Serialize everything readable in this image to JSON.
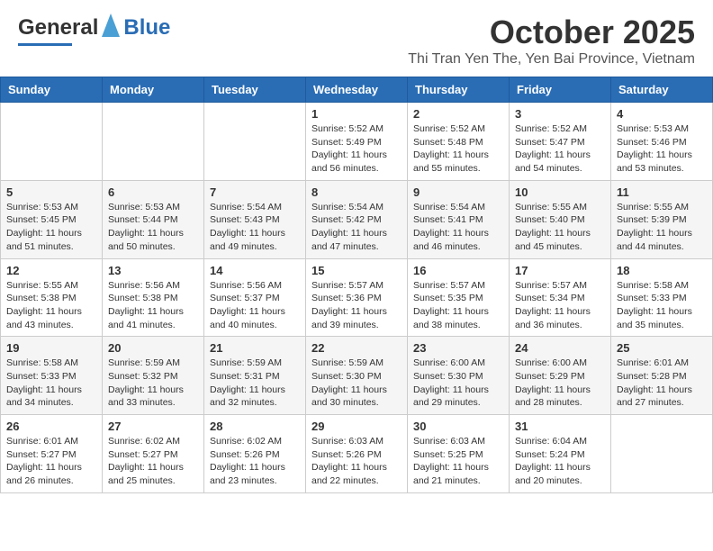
{
  "header": {
    "logo_general": "General",
    "logo_blue": "Blue",
    "month_title": "October 2025",
    "location": "Thi Tran Yen The, Yen Bai Province, Vietnam"
  },
  "weekdays": [
    "Sunday",
    "Monday",
    "Tuesday",
    "Wednesday",
    "Thursday",
    "Friday",
    "Saturday"
  ],
  "weeks": [
    [
      {
        "day": "",
        "info": ""
      },
      {
        "day": "",
        "info": ""
      },
      {
        "day": "",
        "info": ""
      },
      {
        "day": "1",
        "info": "Sunrise: 5:52 AM\nSunset: 5:49 PM\nDaylight: 11 hours and 56 minutes."
      },
      {
        "day": "2",
        "info": "Sunrise: 5:52 AM\nSunset: 5:48 PM\nDaylight: 11 hours and 55 minutes."
      },
      {
        "day": "3",
        "info": "Sunrise: 5:52 AM\nSunset: 5:47 PM\nDaylight: 11 hours and 54 minutes."
      },
      {
        "day": "4",
        "info": "Sunrise: 5:53 AM\nSunset: 5:46 PM\nDaylight: 11 hours and 53 minutes."
      }
    ],
    [
      {
        "day": "5",
        "info": "Sunrise: 5:53 AM\nSunset: 5:45 PM\nDaylight: 11 hours and 51 minutes."
      },
      {
        "day": "6",
        "info": "Sunrise: 5:53 AM\nSunset: 5:44 PM\nDaylight: 11 hours and 50 minutes."
      },
      {
        "day": "7",
        "info": "Sunrise: 5:54 AM\nSunset: 5:43 PM\nDaylight: 11 hours and 49 minutes."
      },
      {
        "day": "8",
        "info": "Sunrise: 5:54 AM\nSunset: 5:42 PM\nDaylight: 11 hours and 47 minutes."
      },
      {
        "day": "9",
        "info": "Sunrise: 5:54 AM\nSunset: 5:41 PM\nDaylight: 11 hours and 46 minutes."
      },
      {
        "day": "10",
        "info": "Sunrise: 5:55 AM\nSunset: 5:40 PM\nDaylight: 11 hours and 45 minutes."
      },
      {
        "day": "11",
        "info": "Sunrise: 5:55 AM\nSunset: 5:39 PM\nDaylight: 11 hours and 44 minutes."
      }
    ],
    [
      {
        "day": "12",
        "info": "Sunrise: 5:55 AM\nSunset: 5:38 PM\nDaylight: 11 hours and 43 minutes."
      },
      {
        "day": "13",
        "info": "Sunrise: 5:56 AM\nSunset: 5:38 PM\nDaylight: 11 hours and 41 minutes."
      },
      {
        "day": "14",
        "info": "Sunrise: 5:56 AM\nSunset: 5:37 PM\nDaylight: 11 hours and 40 minutes."
      },
      {
        "day": "15",
        "info": "Sunrise: 5:57 AM\nSunset: 5:36 PM\nDaylight: 11 hours and 39 minutes."
      },
      {
        "day": "16",
        "info": "Sunrise: 5:57 AM\nSunset: 5:35 PM\nDaylight: 11 hours and 38 minutes."
      },
      {
        "day": "17",
        "info": "Sunrise: 5:57 AM\nSunset: 5:34 PM\nDaylight: 11 hours and 36 minutes."
      },
      {
        "day": "18",
        "info": "Sunrise: 5:58 AM\nSunset: 5:33 PM\nDaylight: 11 hours and 35 minutes."
      }
    ],
    [
      {
        "day": "19",
        "info": "Sunrise: 5:58 AM\nSunset: 5:33 PM\nDaylight: 11 hours and 34 minutes."
      },
      {
        "day": "20",
        "info": "Sunrise: 5:59 AM\nSunset: 5:32 PM\nDaylight: 11 hours and 33 minutes."
      },
      {
        "day": "21",
        "info": "Sunrise: 5:59 AM\nSunset: 5:31 PM\nDaylight: 11 hours and 32 minutes."
      },
      {
        "day": "22",
        "info": "Sunrise: 5:59 AM\nSunset: 5:30 PM\nDaylight: 11 hours and 30 minutes."
      },
      {
        "day": "23",
        "info": "Sunrise: 6:00 AM\nSunset: 5:30 PM\nDaylight: 11 hours and 29 minutes."
      },
      {
        "day": "24",
        "info": "Sunrise: 6:00 AM\nSunset: 5:29 PM\nDaylight: 11 hours and 28 minutes."
      },
      {
        "day": "25",
        "info": "Sunrise: 6:01 AM\nSunset: 5:28 PM\nDaylight: 11 hours and 27 minutes."
      }
    ],
    [
      {
        "day": "26",
        "info": "Sunrise: 6:01 AM\nSunset: 5:27 PM\nDaylight: 11 hours and 26 minutes."
      },
      {
        "day": "27",
        "info": "Sunrise: 6:02 AM\nSunset: 5:27 PM\nDaylight: 11 hours and 25 minutes."
      },
      {
        "day": "28",
        "info": "Sunrise: 6:02 AM\nSunset: 5:26 PM\nDaylight: 11 hours and 23 minutes."
      },
      {
        "day": "29",
        "info": "Sunrise: 6:03 AM\nSunset: 5:26 PM\nDaylight: 11 hours and 22 minutes."
      },
      {
        "day": "30",
        "info": "Sunrise: 6:03 AM\nSunset: 5:25 PM\nDaylight: 11 hours and 21 minutes."
      },
      {
        "day": "31",
        "info": "Sunrise: 6:04 AM\nSunset: 5:24 PM\nDaylight: 11 hours and 20 minutes."
      },
      {
        "day": "",
        "info": ""
      }
    ]
  ]
}
